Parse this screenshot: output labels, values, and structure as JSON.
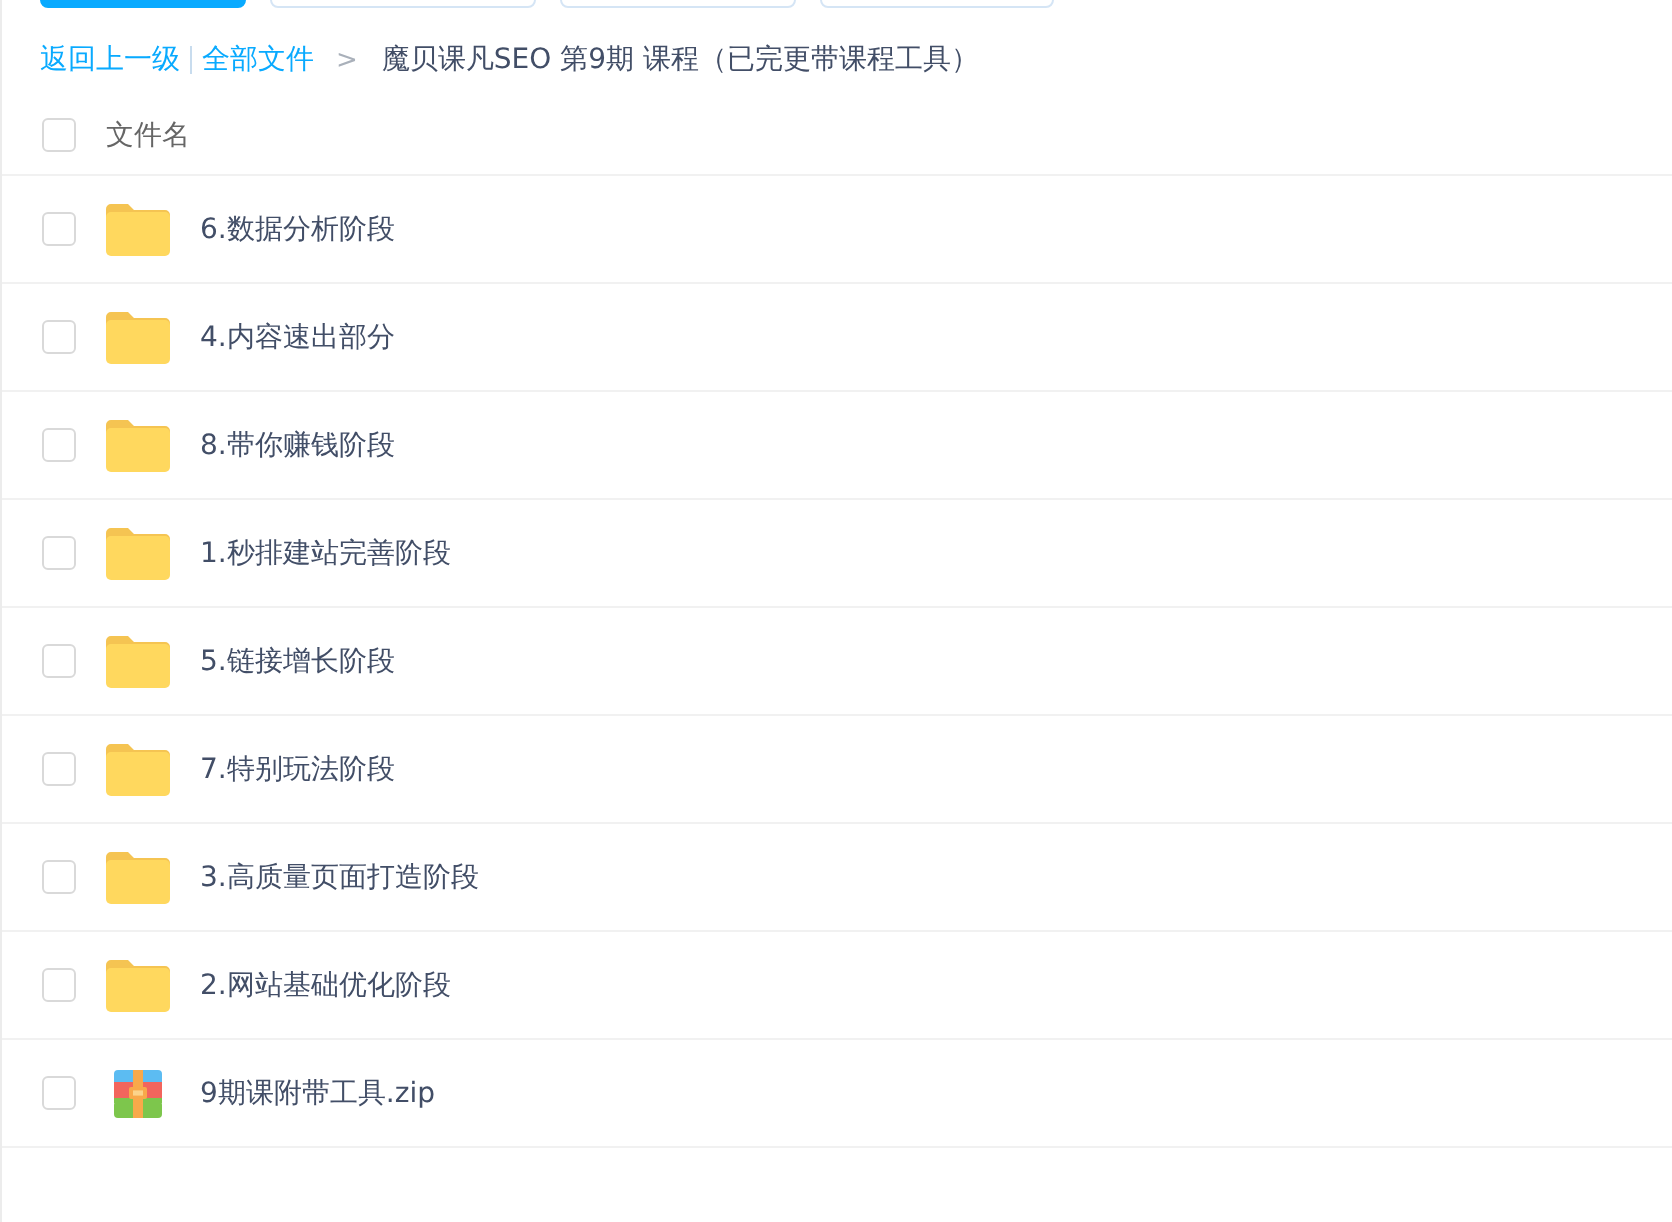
{
  "toolbar": {
    "buttons": [
      {
        "kind": "primary"
      },
      {
        "kind": "outline"
      },
      {
        "kind": "outline"
      },
      {
        "kind": "outline"
      }
    ]
  },
  "breadcrumb": {
    "back": "返回上一级",
    "root": "全部文件",
    "arrow": ">",
    "current": "魔贝课凡SEO 第9期 课程（已完更带课程工具）"
  },
  "header": {
    "checked": false,
    "column_1": "文件名"
  },
  "files": [
    {
      "name": "6.数据分析阶段",
      "kind": "folder",
      "checked": false
    },
    {
      "name": "4.内容速出部分",
      "kind": "folder",
      "checked": false
    },
    {
      "name": "8.带你赚钱阶段",
      "kind": "folder",
      "checked": false
    },
    {
      "name": "1.秒排建站完善阶段",
      "kind": "folder",
      "checked": false
    },
    {
      "name": "5.链接增长阶段",
      "kind": "folder",
      "checked": false
    },
    {
      "name": "7.特别玩法阶段",
      "kind": "folder",
      "checked": false
    },
    {
      "name": "3.高质量页面打造阶段",
      "kind": "folder",
      "checked": false
    },
    {
      "name": "2.网站基础优化阶段",
      "kind": "folder",
      "checked": false
    },
    {
      "name": "9期课附带工具.zip",
      "kind": "archive",
      "checked": false
    }
  ]
}
